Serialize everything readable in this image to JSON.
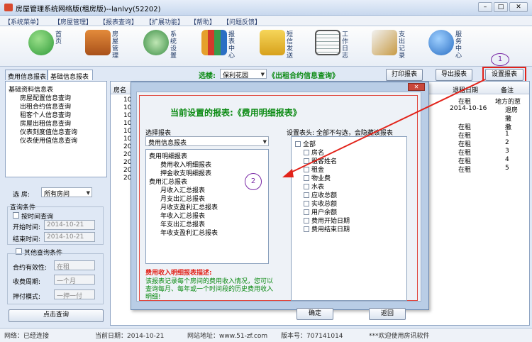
{
  "window": {
    "title": "房屋管理系统网络版(租房版)--lanlvy(52202)"
  },
  "menu": [
    "【系统菜单】",
    "【房屋管理】",
    "【报表查询】",
    "【扩展功能】",
    "【帮助】",
    "【问题反馈】"
  ],
  "toolbar": [
    {
      "label": "首页",
      "icon": "home-icon",
      "color": "#2f9b3a"
    },
    {
      "label": "房屋管理",
      "icon": "house-icon",
      "color": "#c9691e"
    },
    {
      "label": "系统设置",
      "icon": "settings-icon",
      "color": "#3a8e44"
    },
    {
      "label": "报表中心",
      "icon": "report-icon",
      "color": "#d33a2c"
    },
    {
      "label": "短信发送",
      "icon": "sms-icon",
      "color": "#e4b323"
    },
    {
      "label": "工作日志",
      "icon": "notebook-icon",
      "color": "#5c5c5c"
    },
    {
      "label": "支出记录",
      "icon": "expense-icon",
      "color": "#b8862c"
    },
    {
      "label": "服务中心",
      "icon": "globe-icon",
      "color": "#2b6fc4"
    }
  ],
  "tabs": [
    "费用信息报表",
    "基础信息报表"
  ],
  "filter": {
    "label": "选楼:",
    "building": "保利花园",
    "report_title": "《出租合约信息查询》"
  },
  "actions": {
    "print": "打印报表",
    "export": "导出报表",
    "settings": "设置报表"
  },
  "badges": {
    "one": "1",
    "two": "2"
  },
  "tree": {
    "root": "基础资料信息表",
    "items": [
      "房屋配置信息查询",
      "出租合约信息查询",
      "租客个人信息查询",
      "房屋出租信息查询",
      "仪表刻度值信息查询",
      "仪表使用值信息查询"
    ]
  },
  "form": {
    "house_label": "选 房:",
    "house_value": "所有房间",
    "query_group": "查询条件",
    "by_time": "按时间查询",
    "start_label": "开始时间:",
    "start_value": "2014-10-21",
    "end_label": "结束时间:",
    "end_value": "2014-10-21",
    "other_group": "其他查询条件",
    "contract_label": "合约有效性:",
    "contract_value": "在租",
    "period_label": "收费周期:",
    "period_value": "一个月",
    "deposit_label": "押付模式:",
    "deposit_value": "一押一付",
    "query_button": "点击查询"
  },
  "grid": {
    "col_room": "房名",
    "col_date": "退租日期",
    "col_note": "备注",
    "room_fragments": [
      "10",
      "10",
      "10",
      "10",
      "10",
      "10",
      "20",
      "20",
      "20",
      "20",
      "20"
    ],
    "rows": [
      {
        "date": "在租",
        "note": "地方的葱"
      },
      {
        "date": "2014-10-16",
        "note": "退房"
      },
      {
        "date": "",
        "note": "撒"
      },
      {
        "date": "在租",
        "note": "撒"
      },
      {
        "date": "在租",
        "note": "1"
      },
      {
        "date": "在租",
        "note": "2"
      },
      {
        "date": "在租",
        "note": "3"
      },
      {
        "date": "在租",
        "note": "4"
      },
      {
        "date": "在租",
        "note": "5"
      }
    ]
  },
  "dialog": {
    "heading": "当前设置的报表:《费用明细报表》",
    "select_label": "选择报表",
    "select_value": "费用信息报表",
    "report_list": [
      "费用明细报表",
      "费用收入明细报表",
      "押金收支明细报表",
      "费用汇总报表",
      "月收入汇总报表",
      "月支出汇总报表",
      "月收支盈利汇总报表",
      "年收入汇总报表",
      "年支出汇总报表",
      "年收支盈利汇总报表"
    ],
    "header_label": "设置表头: 全部不勾选，会隐藏该报表",
    "columns": [
      "全部",
      "房名",
      "租客姓名",
      "租金",
      "物业费",
      "水表",
      "应收总额",
      "实收总额",
      "用户余额",
      "费用开始日期",
      "费用结束日期"
    ],
    "desc_title": "费用收入明细报表描述:",
    "desc_text": "该报表记录每个房间的费用收入情况，您可以查询每月、每年或一个时间段的历史费用收入明细!",
    "ok": "确定",
    "back": "返回"
  },
  "status": {
    "network": "网络：已经连接",
    "date": "当前日期：2014-10-21",
    "site": "网站地址：www.51-zf.com",
    "version": "版本号：707141014",
    "welcome": "***欢迎使用房讯软件"
  }
}
